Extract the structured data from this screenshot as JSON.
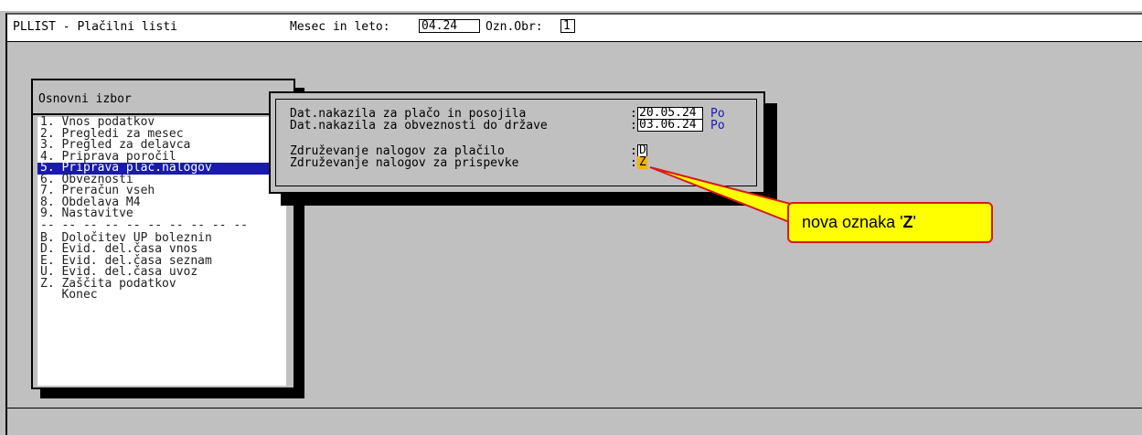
{
  "header": {
    "app_title": "PLLIST - Plačilni listi",
    "period_label": "Mesec in leto:",
    "period_value": "04.24",
    "ozn_label": "Ozn.Obr:",
    "ozn_value": "1"
  },
  "menu": {
    "title": "Osnovni izbor",
    "items": [
      "1. Vnos podatkov",
      "2. Pregledi za mesec",
      "3. Pregled za delavca",
      "4. Priprava poročil",
      "5. Priprava plač.nalogov",
      "6. Obveznosti",
      "7. Preračun vseh",
      "8. Obdelava M4",
      "9. Nastavitve"
    ],
    "separator": "-- -- -- -- -- -- -- -- -- --",
    "items2": [
      "B. Določitev UP boleznin",
      "D. Evid. del.časa vnos",
      "E. Evid. del.časa seznam",
      "U. Evid. del.časa uvoz",
      "Z. Zaščita podatkov",
      "   Konec"
    ],
    "selected_index": 4
  },
  "dialog": {
    "row1_label": "Dat.nakazila za plačo in posojila",
    "row1_value": "20.05.24",
    "row1_tag": "Po",
    "row2_label": "Dat.nakazila za obveznosti do države",
    "row2_value": "03.06.24",
    "row2_tag": "Po",
    "row3_label": "Združevanje nalogov za plačilo",
    "row3_value": "D",
    "row4_label": "Združevanje nalogov za prispevke",
    "row4_value": "Z"
  },
  "callout": {
    "text_prefix": "nova oznaka '",
    "text_bold": "Z",
    "text_suffix": "'"
  },
  "colors": {
    "background": "#c0c0c0",
    "selection": "#1a1ab0",
    "highlight": "#f4b400",
    "callout_fill": "#ffff00",
    "callout_border": "#d81a1a"
  }
}
